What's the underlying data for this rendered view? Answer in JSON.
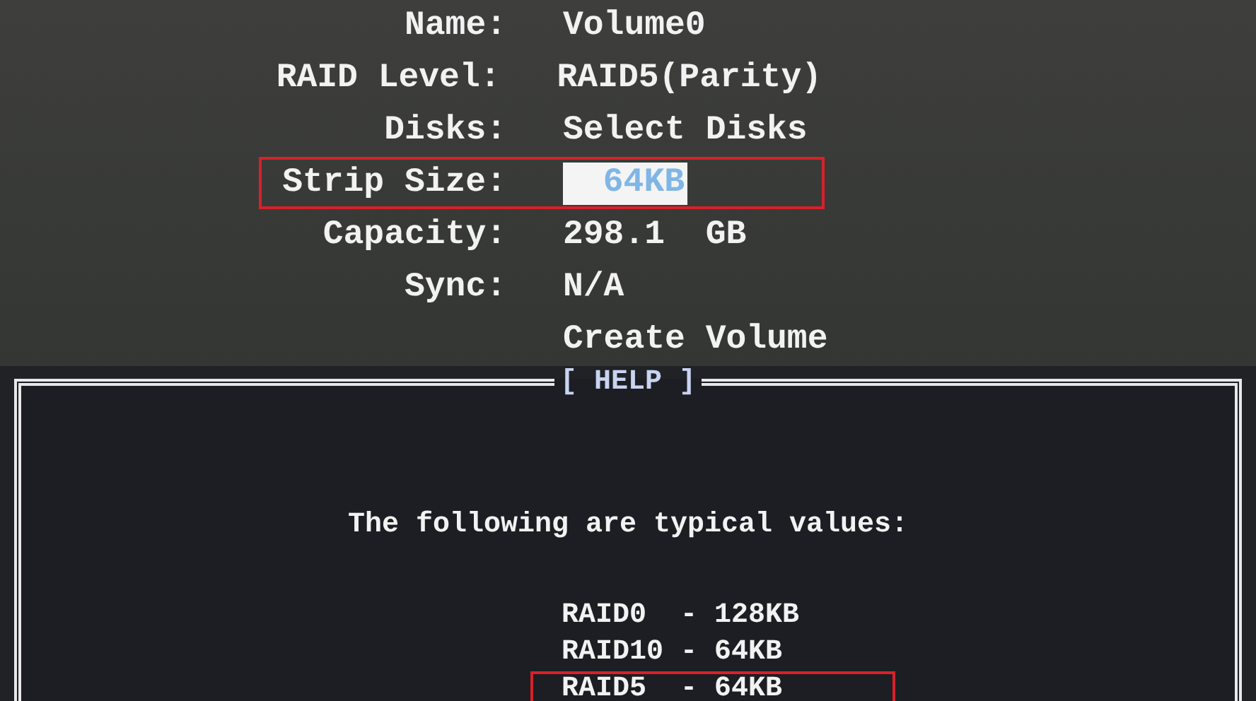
{
  "fields": [
    {
      "label": "Name:",
      "value": "Volume0",
      "selected": false,
      "highlighted": false
    },
    {
      "label": "RAID Level:",
      "value": "RAID5(Parity)",
      "selected": false,
      "highlighted": false
    },
    {
      "label": "Disks:",
      "value": "Select Disks",
      "selected": false,
      "highlighted": false
    },
    {
      "label": "Strip Size:",
      "value": "64KB",
      "selected": true,
      "highlighted": true
    },
    {
      "label": "Capacity:",
      "value": "298.1  GB",
      "selected": false,
      "highlighted": false
    },
    {
      "label": "Sync:",
      "value": "N/A",
      "selected": false,
      "highlighted": false
    }
  ],
  "action": "Create Volume",
  "help": {
    "title": "[ HELP ]",
    "text": "The following are typical values:",
    "lines": [
      {
        "text": "RAID0  - 128KB",
        "highlighted": false
      },
      {
        "text": "RAID10 - 64KB",
        "highlighted": false
      },
      {
        "text": "RAID5  - 64KB",
        "highlighted": true
      }
    ]
  }
}
